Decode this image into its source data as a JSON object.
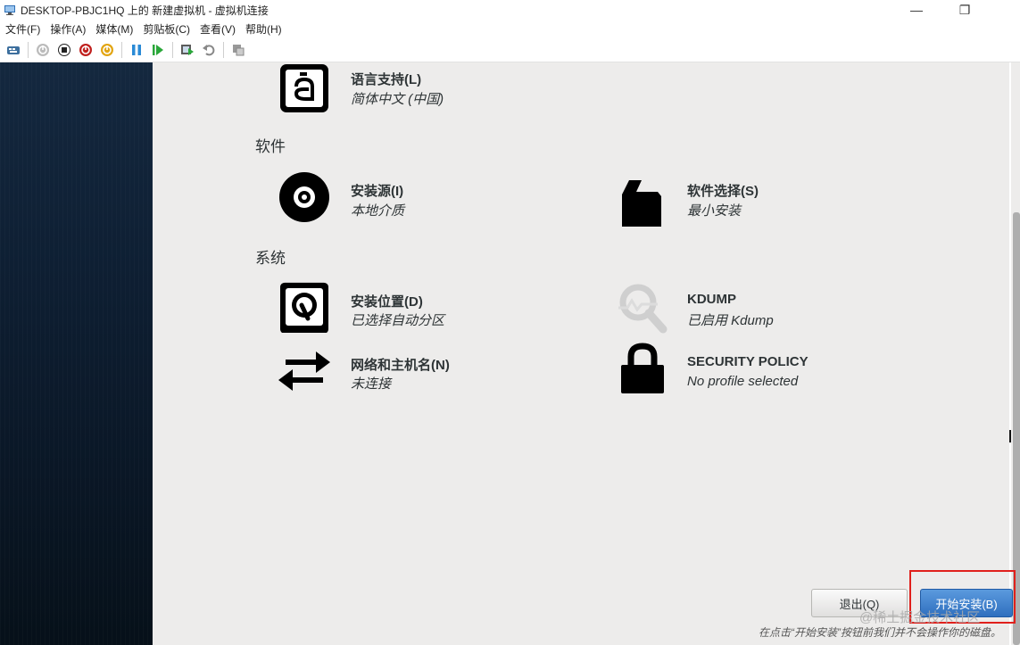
{
  "window": {
    "title": "DESKTOP-PBJC1HQ 上的 新建虚拟机 - 虚拟机连接",
    "minimize_glyph": "—",
    "restore_glyph": "❐"
  },
  "menu": {
    "items": [
      "文件(F)",
      "操作(A)",
      "媒体(M)",
      "剪贴板(C)",
      "查看(V)",
      "帮助(H)"
    ]
  },
  "toolbar": {
    "buttons": [
      "ctrl-alt-del-icon",
      "start-icon",
      "turn-off-icon",
      "shutdown-icon",
      "save-icon",
      "pause-icon",
      "resume-icon",
      "checkpoint-icon",
      "revert-icon",
      "enhanced-session-icon"
    ]
  },
  "installer": {
    "language": {
      "title": "语言支持(L)",
      "status": "简体中文 (中国)"
    },
    "software_section": "软件",
    "install_source": {
      "title": "安装源(I)",
      "status": "本地介质"
    },
    "software_selection": {
      "title": "软件选择(S)",
      "status": "最小安装"
    },
    "system_section": "系统",
    "install_destination": {
      "title": "安装位置(D)",
      "status": "已选择自动分区"
    },
    "kdump": {
      "title": "KDUMP",
      "status": "已启用 Kdump"
    },
    "network": {
      "title": "网络和主机名(N)",
      "status": "未连接"
    },
    "security_policy": {
      "title": "SECURITY POLICY",
      "status": "No profile selected"
    },
    "quit_button": "退出(Q)",
    "begin_button": "开始安装(B)",
    "hint": "在点击“开始安装”按钮前我们并不会操作你的磁盘。"
  },
  "watermark": "@稀土掘金技术社区",
  "colors": {
    "accent_button": "#2f6fbe",
    "highlight_box": "#e0201c",
    "sidebar": "#0e1f33",
    "content_bg": "#edeceb"
  }
}
